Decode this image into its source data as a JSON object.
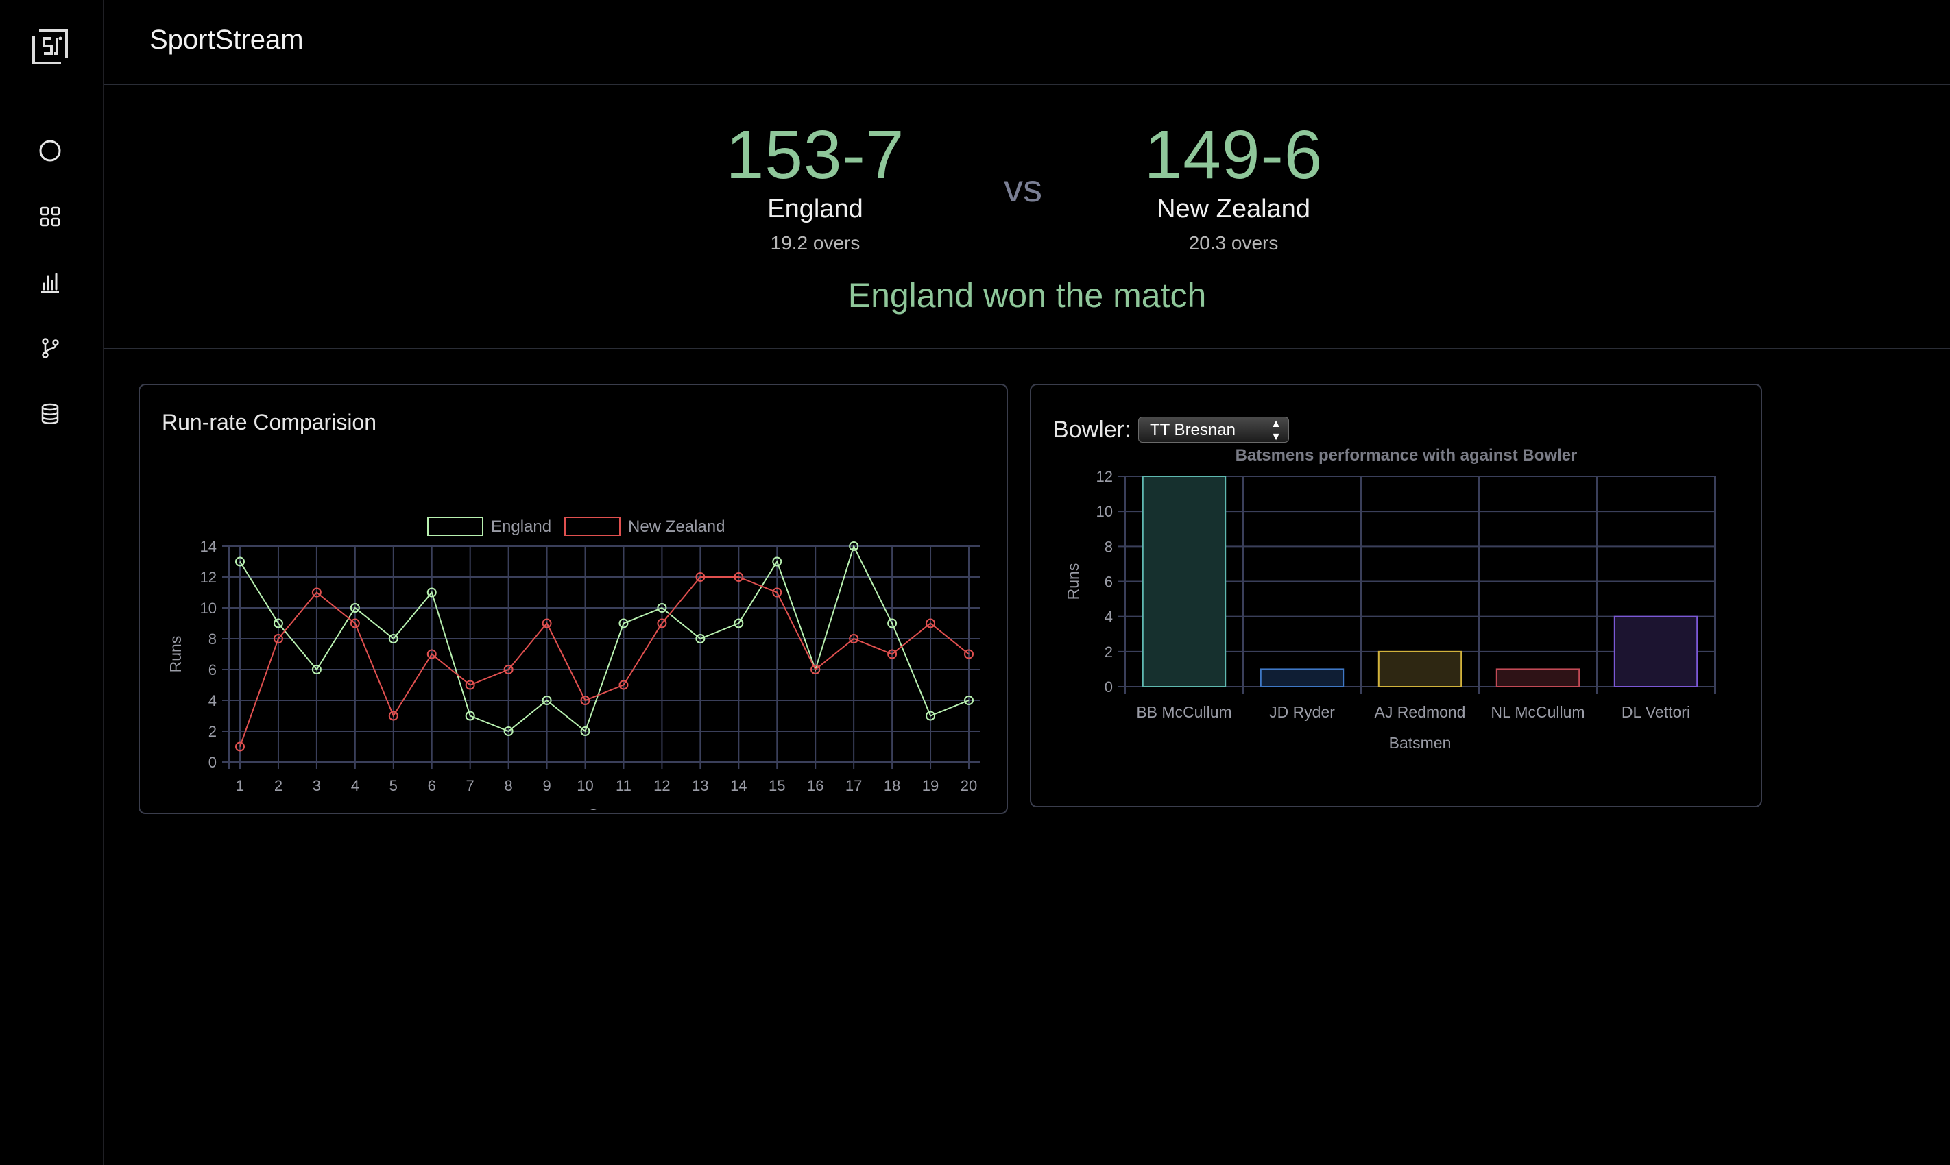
{
  "app": {
    "title": "SportStream"
  },
  "sidebar": {
    "items": [
      {
        "icon": "circle-icon"
      },
      {
        "icon": "grid-icon"
      },
      {
        "icon": "bar-chart-icon"
      },
      {
        "icon": "git-branch-icon"
      },
      {
        "icon": "database-icon"
      }
    ]
  },
  "match": {
    "team1": {
      "score": "153-7",
      "name": "England",
      "overs": "19.2 overs"
    },
    "vs": "vs",
    "team2": {
      "score": "149-6",
      "name": "New Zealand",
      "overs": "20.3 overs"
    },
    "result": "England won the match"
  },
  "run_rate_card": {
    "title": "Run-rate Comparision"
  },
  "bowler_card": {
    "label": "Bowler:",
    "selected": "TT Bresnan"
  },
  "colors": {
    "accent_green": "#8fc79a",
    "england": "#b8f0b0",
    "new_zealand": "#e0504f",
    "grid": "#3a3f5a"
  },
  "chart_data": [
    {
      "type": "line",
      "title": "",
      "xlabel": "Over",
      "ylabel": "Runs",
      "x": [
        1,
        2,
        3,
        4,
        5,
        6,
        7,
        8,
        9,
        10,
        11,
        12,
        13,
        14,
        15,
        16,
        17,
        18,
        19,
        20
      ],
      "ylim": [
        0,
        14
      ],
      "yticks": [
        0,
        2,
        4,
        6,
        8,
        10,
        12,
        14
      ],
      "legend": "top",
      "grid": true,
      "series": [
        {
          "name": "England",
          "color": "#b8f0b0",
          "values": [
            13,
            9,
            6,
            10,
            8,
            11,
            3,
            2,
            4,
            2,
            9,
            10,
            8,
            9,
            13,
            6,
            14,
            9,
            3,
            4
          ]
        },
        {
          "name": "New Zealand",
          "color": "#e0504f",
          "values": [
            1,
            8,
            11,
            9,
            3,
            7,
            5,
            6,
            9,
            4,
            5,
            9,
            12,
            12,
            11,
            6,
            8,
            7,
            9,
            7
          ]
        }
      ]
    },
    {
      "type": "bar",
      "title": "Batsmens performance with against Bowler",
      "xlabel": "Batsmen",
      "ylabel": "Runs",
      "categories": [
        "BB McCullum",
        "JD Ryder",
        "AJ Redmond",
        "NL McCullum",
        "DL Vettori"
      ],
      "values": [
        12,
        1,
        2,
        1,
        4
      ],
      "ylim": [
        0,
        12
      ],
      "yticks": [
        0,
        2,
        4,
        6,
        8,
        10,
        12
      ],
      "grid": true,
      "colors": [
        {
          "fill": "#16302e",
          "stroke": "#5fb8b0"
        },
        {
          "fill": "#0f1e34",
          "stroke": "#3f78c6"
        },
        {
          "fill": "#2e2712",
          "stroke": "#d2b33c"
        },
        {
          "fill": "#2e1216",
          "stroke": "#c24a56"
        },
        {
          "fill": "#1c1430",
          "stroke": "#7b58d6"
        }
      ]
    }
  ]
}
